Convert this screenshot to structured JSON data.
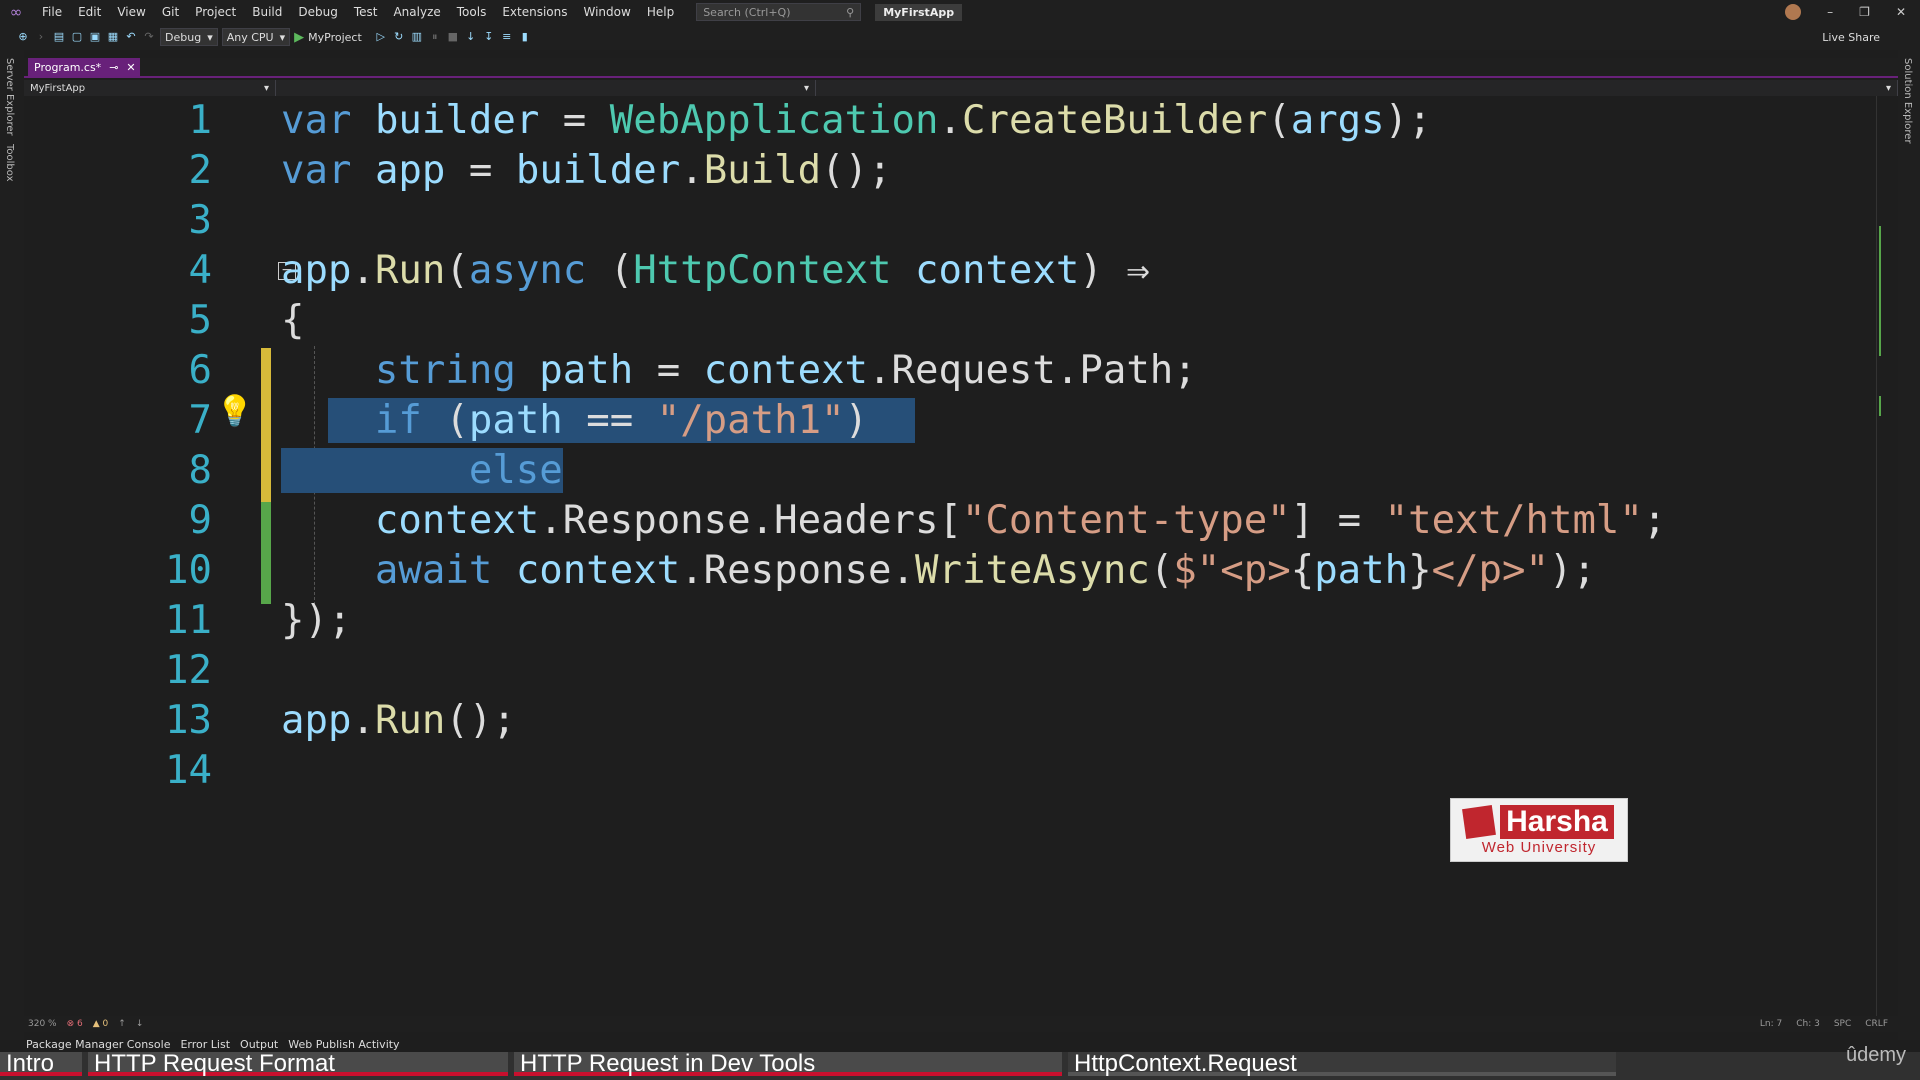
{
  "menubar": {
    "items": [
      "File",
      "Edit",
      "View",
      "Git",
      "Project",
      "Build",
      "Debug",
      "Test",
      "Analyze",
      "Tools",
      "Extensions",
      "Window",
      "Help"
    ],
    "search_placeholder": "Search (Ctrl+Q)",
    "app_title": "MyFirstApp"
  },
  "toolbar": {
    "config": "Debug",
    "platform": "Any CPU",
    "run_target": "MyProject",
    "live_share": "Live Share"
  },
  "side_panels": {
    "left": [
      "Server Explorer",
      "Toolbox"
    ],
    "right": "Solution Explorer"
  },
  "editor": {
    "tab_label": "Program.cs*",
    "nav_project": "MyFirstApp",
    "line_numbers": [
      "1",
      "2",
      "3",
      "4",
      "5",
      "6",
      "7",
      "8",
      "9",
      "10",
      "11",
      "12",
      "13",
      "14"
    ]
  },
  "status": {
    "zoom": "320 %",
    "errors": "6",
    "warnings": "0",
    "ln": "Ln: 7",
    "ch": "Ch: 3",
    "spc": "SPC",
    "crlf": "CRLF"
  },
  "panel_tabs": [
    "Package Manager Console",
    "Error List",
    "Output",
    "Web Publish Activity"
  ],
  "watermark": {
    "name": "Harsha",
    "sub": "Web University"
  },
  "chapters": [
    "Intro",
    "HTTP Request Format",
    "HTTP Request in Dev Tools",
    "HttpContext.Request"
  ],
  "brand": "ûdemy",
  "colors": {
    "keyword": "#569cd6",
    "type": "#4ec9b0",
    "identifier": "#9cdcfe",
    "method": "#dcdcaa",
    "string": "#d69d85",
    "selection": "#264f78",
    "line_number": "#3ab0c8",
    "accent": "#68217a"
  }
}
